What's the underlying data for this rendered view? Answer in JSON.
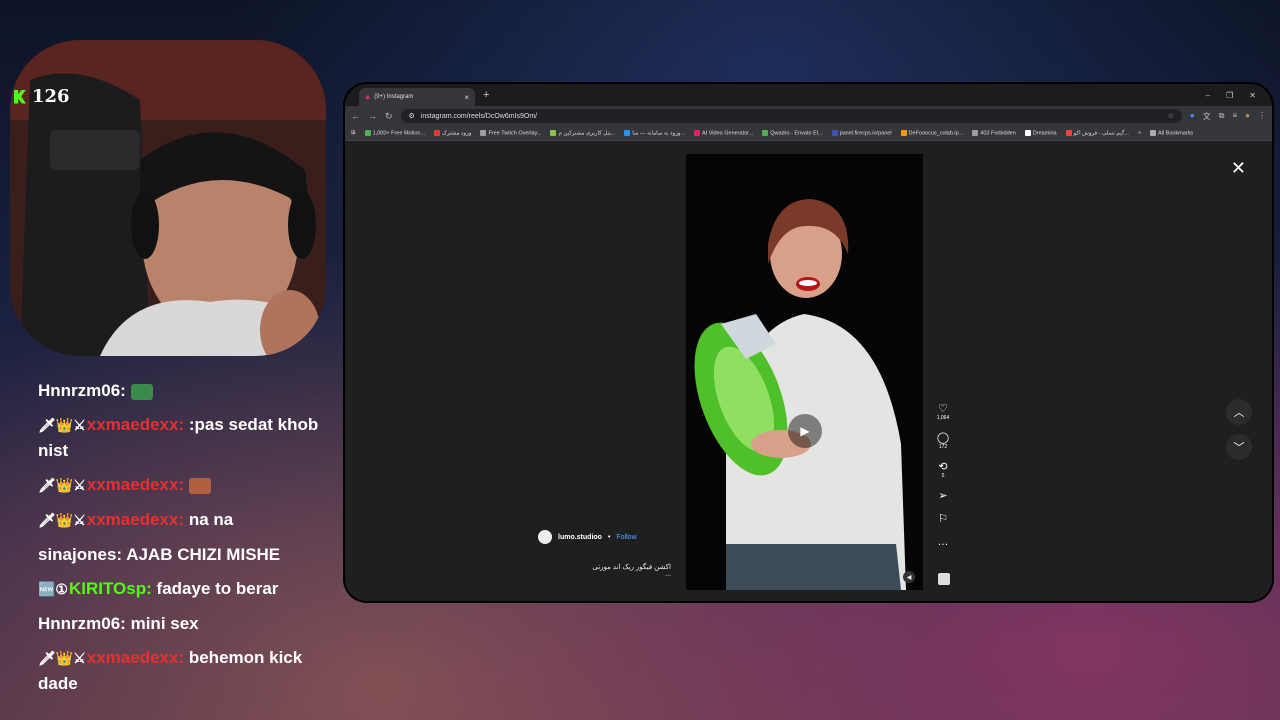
{
  "viewer_count": "126",
  "chat": [
    {
      "user": "Hnnrzm06:",
      "user_color": "#ffffff",
      "badges": "",
      "text": "",
      "emote": "#3a8a4a"
    },
    {
      "user": "xxmaedexx:",
      "user_color": "#e53030",
      "badges": "🗡👑⚔",
      "text": ":pas sedat khob nist",
      "emote": ""
    },
    {
      "user": "xxmaedexx:",
      "user_color": "#e53030",
      "badges": "🗡👑⚔",
      "text": "",
      "emote": "#b06040"
    },
    {
      "user": "xxmaedexx:",
      "user_color": "#e53030",
      "badges": "🗡👑⚔",
      "text": "na na",
      "emote": ""
    },
    {
      "user": "sinajones:",
      "user_color": "#ffffff",
      "badges": "",
      "text": "AJAB CHIZI MISHE",
      "emote": ""
    },
    {
      "user": "KIRITOsp:",
      "user_color": "#53fc18",
      "badges": "🆕①",
      "text": "fadaye to berar",
      "emote": ""
    },
    {
      "user": "Hnnrzm06:",
      "user_color": "#ffffff",
      "badges": "",
      "text": "mini sex",
      "emote": ""
    },
    {
      "user": "xxmaedexx:",
      "user_color": "#e53030",
      "badges": "🗡👑⚔",
      "text": "behemon kick dade",
      "emote": ""
    }
  ],
  "browser": {
    "tab_title": "(9+) Instagram",
    "url": "instagram.com/reels/DcOw6mIs9Om/",
    "bookmarks": [
      {
        "label": "1,000+ Free Motion...",
        "color": "#4caf50"
      },
      {
        "label": "ورود مشترک",
        "color": "#e53935"
      },
      {
        "label": "Free Twitch Overlay...",
        "color": "#9e9e9e"
      },
      {
        "label": "پنل کاربری مشترکین م...",
        "color": "#8bc34a"
      },
      {
        "label": "ورود به سامانه — سا...",
        "color": "#2196f3"
      },
      {
        "label": "AI Video Generator...",
        "color": "#e91e63"
      },
      {
        "label": "Qwadro - Envato El...",
        "color": "#4caf50"
      },
      {
        "label": "panel.firecps.io/panel",
        "color": "#3f51b5"
      },
      {
        "label": "DeFooocus_colab.ip...",
        "color": "#ff9800"
      },
      {
        "label": "403 Forbidden",
        "color": "#9e9e9e"
      },
      {
        "label": "Dreamina",
        "color": "#ffffff"
      },
      {
        "label": "گیم نسلی - فروش اکو...",
        "color": "#f44336"
      }
    ],
    "all_bookmarks": "All Bookmarks"
  },
  "reel": {
    "account": "lumo.studioo",
    "follow": "Follow",
    "caption": "اکشن فیگور ریک اند مورتی",
    "caption_more": "...",
    "likes": "1,064",
    "comments": "172",
    "reposts": "5"
  }
}
